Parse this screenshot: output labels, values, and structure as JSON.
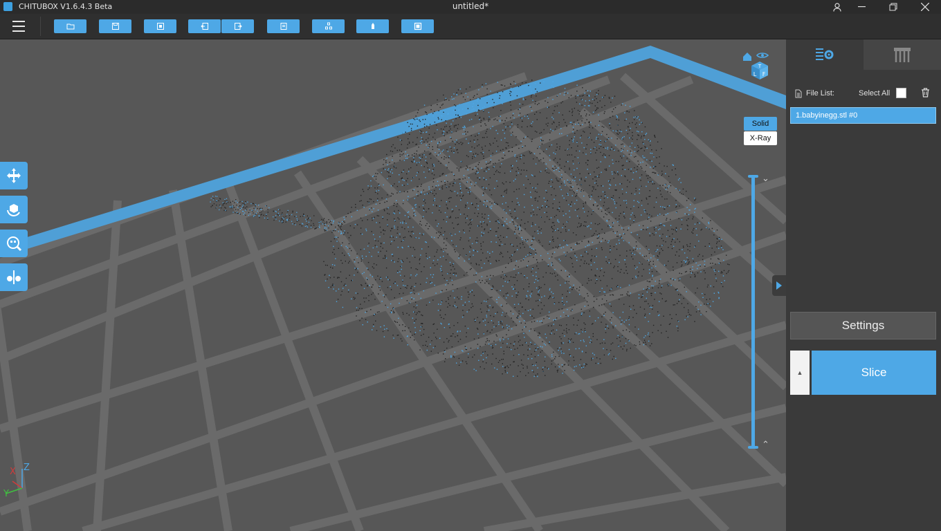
{
  "window": {
    "app_title": "CHITUBOX V1.6.4.3 Beta",
    "doc_title": "untitled*"
  },
  "toolbar": {
    "buttons": [
      "open-icon",
      "save-icon",
      "export-icon",
      "undo-icon",
      "redo-icon",
      "copy-icon",
      "arrange-icon",
      "support-icon",
      "hollow-icon"
    ]
  },
  "view": {
    "solid_label": "Solid",
    "xray_label": "X-Ray",
    "cube_labels": [
      "T",
      "L",
      "F"
    ]
  },
  "axes": {
    "x": "X",
    "y": "Y",
    "z": "Z"
  },
  "panel": {
    "file_list_label": "File List:",
    "select_all_label": "Select All",
    "files": [
      "1.babyinegg.stl #0"
    ],
    "settings_label": "Settings",
    "slice_label": "Slice"
  },
  "colors": {
    "accent": "#4ea8e6",
    "panel_bg": "#3a3a3a",
    "titlebar": "#2b2b2b"
  }
}
